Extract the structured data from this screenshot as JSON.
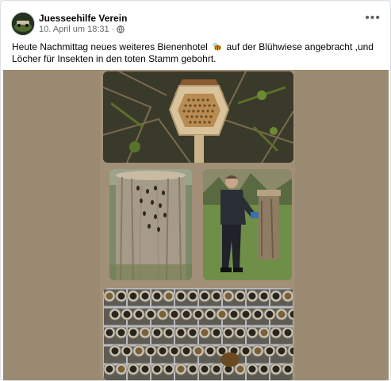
{
  "post": {
    "author": "Juesseehilfe Verein",
    "timestamp": "10. April um 18:31",
    "separator": "·",
    "privacy_icon": "globe-icon",
    "more_icon": "more-options-icon",
    "text_part1": "Heute Nachmittag neues weiteres  Bienenhotel",
    "text_emoji": "bee-emoji",
    "text_part2": "auf der Blühwiese angebracht ,und Löcher für Insekten in den toten Stamm gebohrt."
  },
  "media": {
    "photos": [
      {
        "name": "photo-bee-hotel-hexagon"
      },
      {
        "name": "photo-tree-stump-holes"
      },
      {
        "name": "photo-man-drilling-stump"
      },
      {
        "name": "photo-bee-hotel-tubes"
      }
    ]
  },
  "colors": {
    "background": "#f0f2f5",
    "card": "#ffffff",
    "media_bg": "#9a8a72",
    "text": "#050505",
    "meta": "#65676b"
  }
}
